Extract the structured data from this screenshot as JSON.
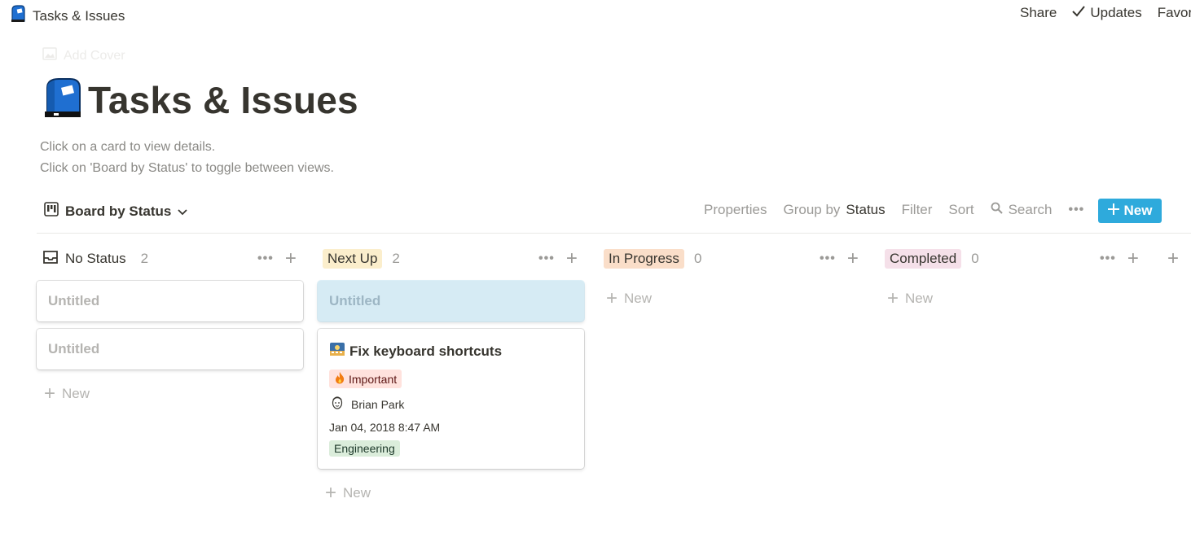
{
  "topbar": {
    "breadcrumb": "Tasks & Issues",
    "share": "Share",
    "updates": "Updates",
    "favorite": "Favor"
  },
  "header": {
    "add_cover": "Add Cover",
    "title": "Tasks & Issues",
    "description_line1": "Click on a card to view details.",
    "description_line2": "Click on 'Board by Status' to toggle between views."
  },
  "toolbar": {
    "view_name": "Board by Status",
    "properties": "Properties",
    "group_by_prefix": "Group by",
    "group_by_value": "Status",
    "filter": "Filter",
    "sort": "Sort",
    "search": "Search",
    "more": "•••",
    "new_button": "New"
  },
  "board": {
    "columns": [
      {
        "name": "No Status",
        "count": "2",
        "tag_color": "transparent"
      },
      {
        "name": "Next Up",
        "count": "2",
        "tag_color": "#fbeecc"
      },
      {
        "name": "In Progress",
        "count": "0",
        "tag_color": "#fadec9"
      },
      {
        "name": "Completed",
        "count": "0",
        "tag_color": "#f5e0e9"
      }
    ],
    "add_group": "+",
    "new_label": "New",
    "untitled": "Untitled",
    "task_card": {
      "title": "Fix keyboard shortcuts",
      "priority": "Important",
      "assignee": "Brian Park",
      "date": "Jan 04, 2018 8:47 AM",
      "team": "Engineering"
    }
  },
  "colors": {
    "accent": "#2eaadc",
    "important_bg": "#ffe2dd",
    "engineering_bg": "#dbeddb"
  }
}
